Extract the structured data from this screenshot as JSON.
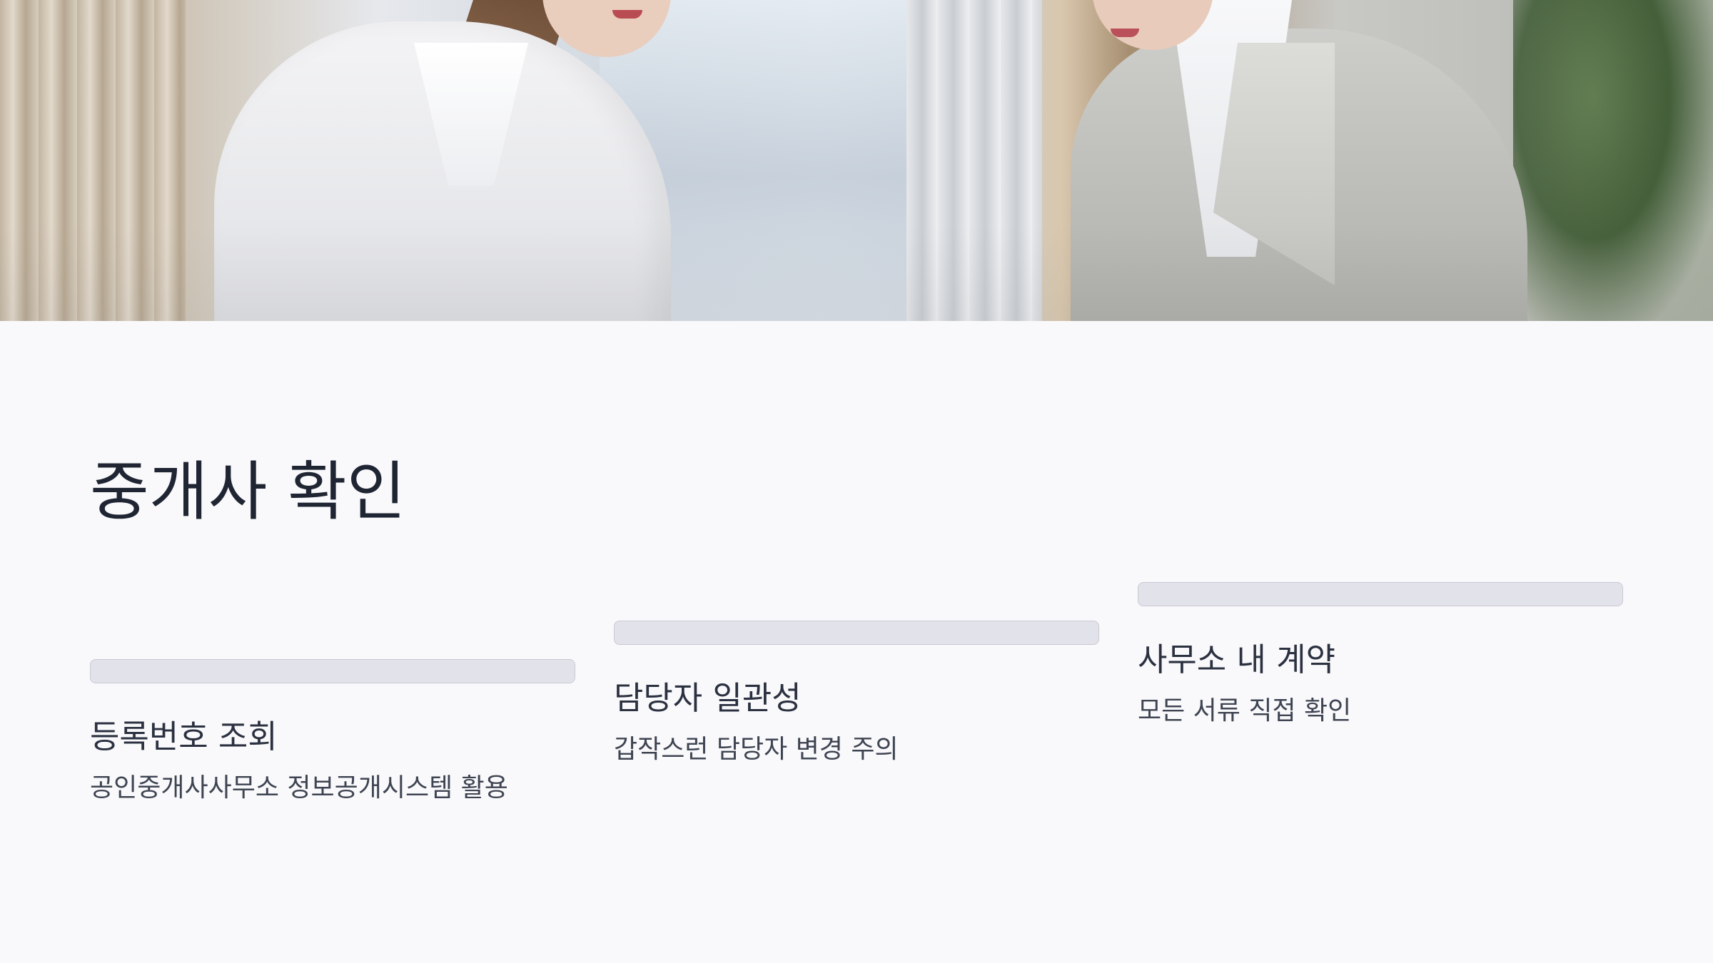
{
  "hero": {
    "image_alt": "office-meeting-photo"
  },
  "title": "중개사 확인",
  "cards": [
    {
      "title": "등록번호 조회",
      "description": "공인중개사사무소 정보공개시스템 활용"
    },
    {
      "title": "담당자 일관성",
      "description": "갑작스런 담당자 변경 주의"
    },
    {
      "title": "사무소 내 계약",
      "description": "모든 서류 직접 확인"
    }
  ],
  "colors": {
    "background": "#f9f9fb",
    "bar": "#e2e2ea",
    "title": "#1f2533",
    "text": "#3e4452"
  }
}
